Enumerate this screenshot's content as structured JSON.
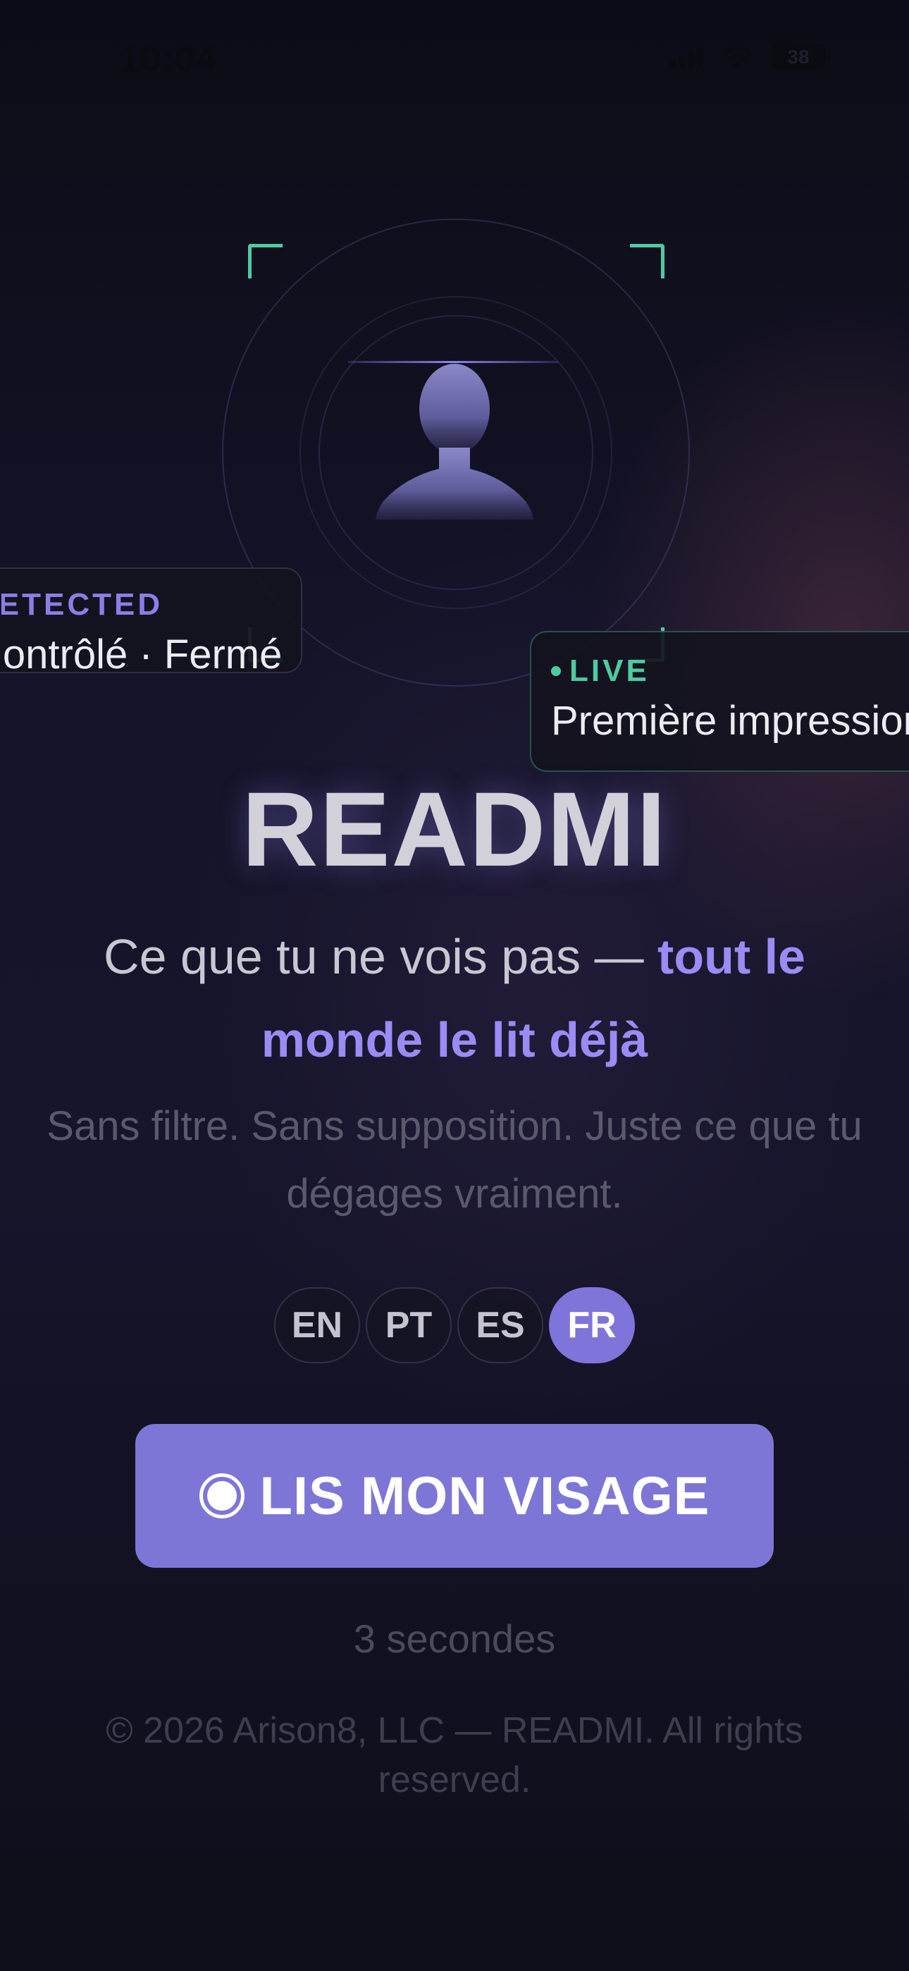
{
  "status_bar": {
    "time": "10:04",
    "battery": "38",
    "icons": [
      "signal-icon",
      "wifi-icon",
      "battery-icon"
    ]
  },
  "scanner": {
    "detected_card": {
      "tag": "DETECTED",
      "text": "Contrôlé · Fermé"
    },
    "live_card": {
      "tag": "LIVE",
      "text": "Première impression"
    },
    "accent_color": "#4ecba1"
  },
  "app_title": "READMI",
  "tagline": {
    "plain": "Ce que tu ne vois pas — ",
    "accent": "tout le monde le lit déjà"
  },
  "subtext": "Sans filtre. Sans supposition. Juste ce que tu dégages vraiment.",
  "languages": [
    {
      "code": "EN",
      "active": false
    },
    {
      "code": "PT",
      "active": false
    },
    {
      "code": "ES",
      "active": false
    },
    {
      "code": "FR",
      "active": true
    }
  ],
  "cta": {
    "label": "LIS MON VISAGE",
    "icon": "record-icon",
    "color": "#7e76d6"
  },
  "duration": "3 secondes",
  "footer": "© 2026 Arison8, LLC — READMI. All rights reserved."
}
